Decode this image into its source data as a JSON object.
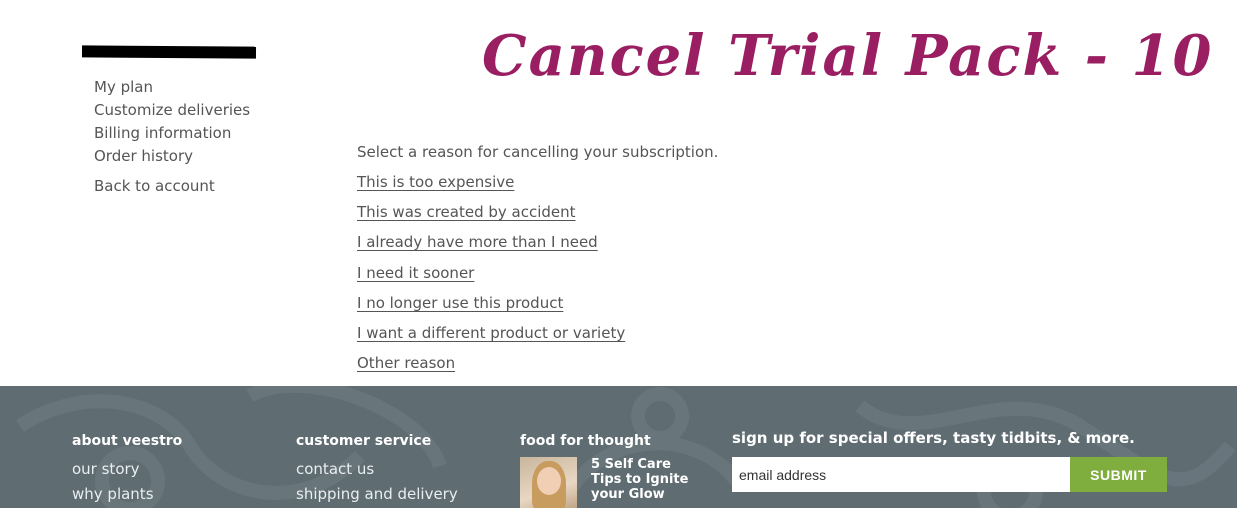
{
  "sidebar": {
    "items": [
      {
        "label": "My plan"
      },
      {
        "label": "Customize deliveries"
      },
      {
        "label": "Billing information"
      },
      {
        "label": "Order history"
      }
    ],
    "back_label": "Back to account"
  },
  "main": {
    "title": "Cancel Trial Pack - 10",
    "intro": "Select a reason for cancelling your subscription.",
    "reasons": [
      "This is too expensive",
      "This was created by accident",
      "I already have more than I need",
      "I need it sooner",
      "I no longer use this product",
      "I want a different product or variety",
      "Other reason"
    ]
  },
  "footer": {
    "about": {
      "heading": "about veestro",
      "links": [
        "our story",
        "why plants"
      ]
    },
    "service": {
      "heading": "customer service",
      "links": [
        "contact us",
        "shipping and delivery"
      ]
    },
    "thought": {
      "heading": "food for thought",
      "article_title": "5 Self Care Tips to Ignite your Glow"
    },
    "signup": {
      "heading": "sign up for special offers, tasty tidbits, & more.",
      "email_placeholder": "email address",
      "submit_label": "SUBMIT"
    }
  },
  "colors": {
    "accent": "#9a1f62",
    "footer_bg": "#5f6c72",
    "submit_bg": "#7fae3f"
  }
}
